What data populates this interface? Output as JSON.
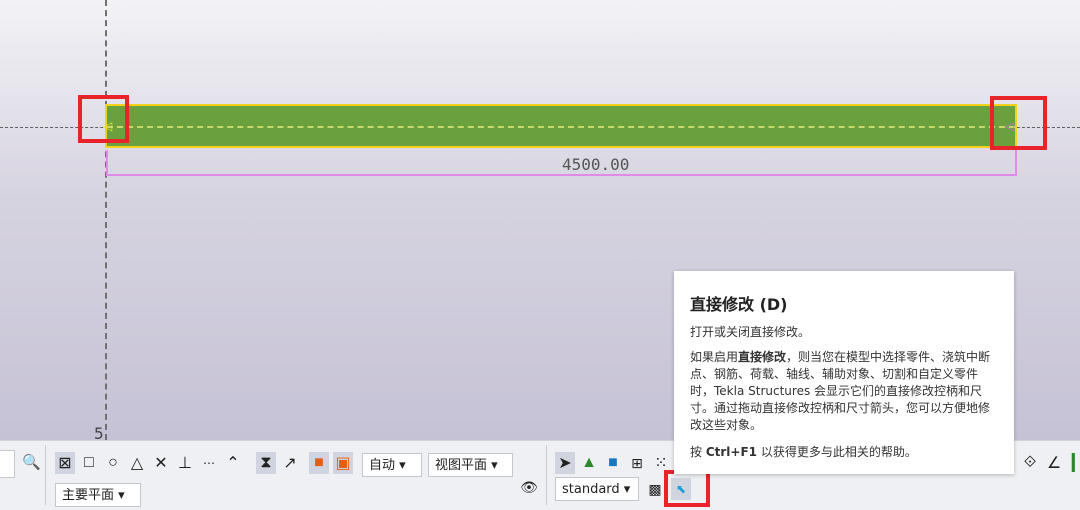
{
  "viewport": {
    "grid_label": "5",
    "dimension_value": "4500.00"
  },
  "toolbar": {
    "search_icon": "search-icon",
    "auto_dropdown": "自动",
    "view_plane_dropdown": "视图平面",
    "main_plane_dropdown": "主要平面",
    "standard_dropdown": "standard"
  },
  "tooltip": {
    "title": "直接修改 (D)",
    "subtitle": "打开或关闭直接修改。",
    "body_prefix": "如果启用",
    "body_bold": "直接修改",
    "body_rest": "，则当您在模型中选择零件、浇筑中断点、钢筋、荷载、轴线、辅助对象、切割和自定义零件时，Tekla Structures 会显示它们的直接修改控柄和尺寸。通过拖动直接修改控柄和尺寸箭头，您可以方便地修改这些对象。",
    "help_prefix": "按",
    "help_key": "Ctrl+F1",
    "help_suffix": "以获得更多与此相关的帮助。"
  },
  "colors": {
    "beam": "#6aa03e",
    "beam_outline": "#f3d21c",
    "dimension": "#e08be8",
    "highlight": "#e8242a"
  }
}
